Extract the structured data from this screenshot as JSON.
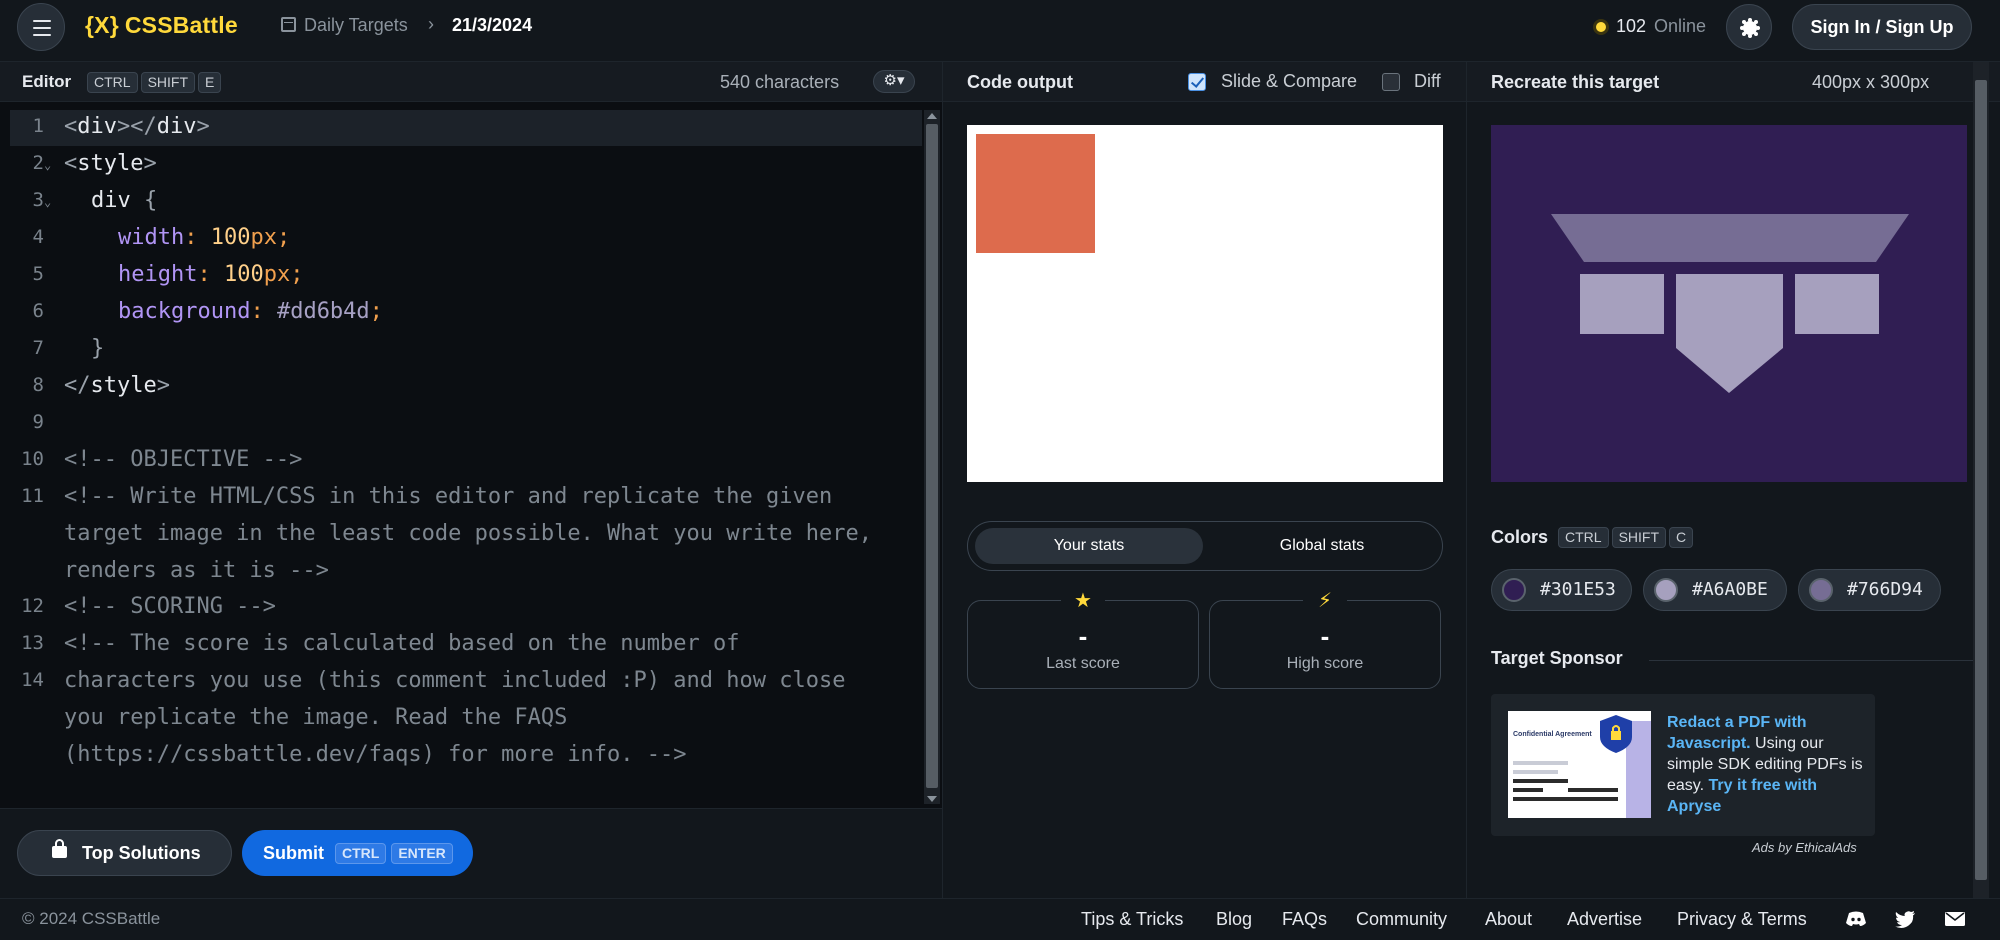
{
  "header": {
    "logo_brace": "{X}",
    "logo_text": "CSSBattle",
    "breadcrumb_1": "Daily Targets",
    "breadcrumb_sep": "›",
    "breadcrumb_2": "21/3/2024",
    "online_count": "102",
    "online_label": "Online",
    "signin_label": "Sign In / Sign Up",
    "icons": [
      "menu-icon",
      "calendar-icon",
      "sun-icon"
    ]
  },
  "editor": {
    "title": "Editor",
    "shortcut": [
      "CTRL",
      "SHIFT",
      "E"
    ],
    "char_count": "540 characters",
    "settings_glyph": "⚙▾",
    "line_numbers": [
      "1",
      "2",
      "3",
      "4",
      "5",
      "6",
      "7",
      "8",
      "9",
      "10",
      "11",
      "12",
      "13",
      "14"
    ],
    "code": {
      "l1_open": "<",
      "l1_tag": "div",
      "l1_close": "></",
      "l1_tag2": "div",
      "l1_end": ">",
      "l2_open": "<",
      "l2_tag": "style",
      "l2_end": ">",
      "l3_sel": "div",
      "l3_brace": " {",
      "l4_prop": "width",
      "l4_colon": ": ",
      "l4_num": "100",
      "l4_unit": "px;",
      "l5_prop": "height",
      "l5_colon": ": ",
      "l5_num": "100",
      "l5_unit": "px;",
      "l6_prop": "background",
      "l6_colon": ": ",
      "l6_val": "#dd6b4d",
      "l6_semi": ";",
      "l7_brace": "}",
      "l8_open": "</",
      "l8_tag": "style",
      "l8_end": ">",
      "l10": "<!-- OBJECTIVE -->",
      "l11_a": "<!-- Write HTML/CSS in this editor and replicate the given",
      "l11_b": "target image in the least code possible. What you write here,",
      "l11_c": "renders as it is -->",
      "l13": "<!-- SCORING -->",
      "l14_a": "<!-- The score is calculated based on the number of",
      "l14_b": "characters you use (this comment included :P) and how close",
      "l14_c": "you replicate the image. Read the FAQS",
      "l14_d": "(https://cssbattle.dev/faqs) for more info. -->"
    },
    "top_solutions_label": "Top Solutions",
    "submit_label": "Submit",
    "submit_shortcut": [
      "CTRL",
      "ENTER"
    ]
  },
  "output": {
    "title": "Code output",
    "slide_compare_label": "Slide & Compare",
    "slide_compare_checked": true,
    "diff_label": "Diff",
    "diff_checked": false,
    "stats_tabs": [
      "Your stats",
      "Global stats"
    ],
    "last_score_value": "-",
    "last_score_label": "Last score",
    "high_score_value": "-",
    "high_score_label": "High score",
    "last_score_icon": "★",
    "high_score_icon": "⚡",
    "square_color": "#dd6b4d"
  },
  "target": {
    "title": "Recreate this target",
    "size": "400px x 300px",
    "colors_label": "Colors",
    "colors_shortcut": [
      "CTRL",
      "SHIFT",
      "C"
    ],
    "colors": [
      "#301E53",
      "#A6A0BE",
      "#766D94"
    ],
    "sponsor_label": "Target Sponsor",
    "ad_link_1": "Redact a PDF with Javascript.",
    "ad_body": " Using our simple SDK editing PDFs is easy. ",
    "ad_link_2": "Try it free with Apryse",
    "ad_doc_title": "Confidential Agreement",
    "ads_by": "Ads by EthicalAds"
  },
  "footer": {
    "copyright": "© 2024 CSSBattle",
    "links": [
      "Tips & Tricks",
      "Blog",
      "FAQs",
      "Community",
      "About",
      "Advertise",
      "Privacy & Terms"
    ],
    "icons": [
      "discord-icon",
      "twitter-icon",
      "mail-icon"
    ]
  }
}
